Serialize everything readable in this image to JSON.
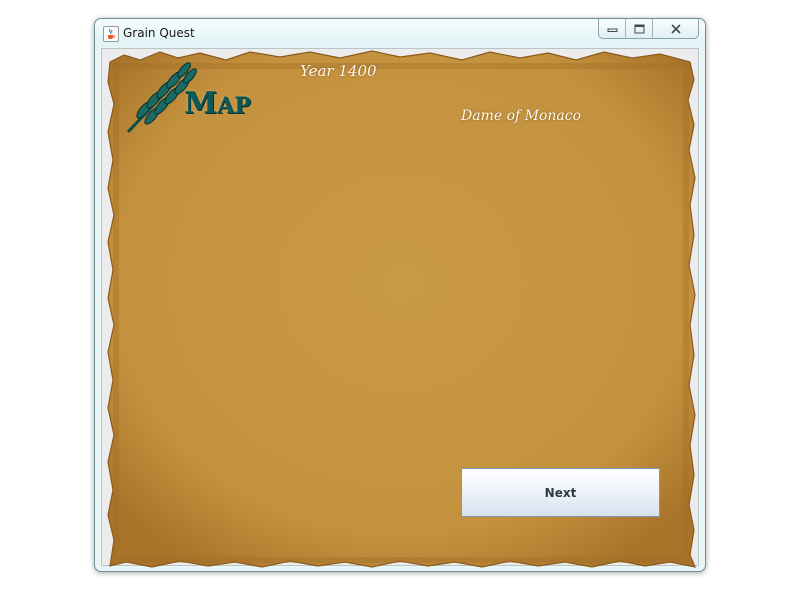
{
  "window": {
    "title": "Grain Quest",
    "minimize_glyph": "▭",
    "maximize_glyph": "◻",
    "close_glyph": "✕"
  },
  "map": {
    "title_first": "M",
    "title_rest": "AP",
    "year": "Year 1400",
    "player": "Dame  of Monaco",
    "next_label": "Next"
  },
  "icons": {
    "app": "java-cup-icon",
    "logo": "wheat-icon"
  },
  "colors": {
    "parchment": "#c99a44",
    "parchment_edge": "#9c6a22",
    "title_teal": "#0c5a58",
    "button_border": "#7d96b4"
  }
}
